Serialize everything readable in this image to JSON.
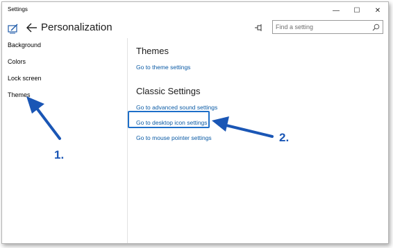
{
  "window": {
    "title": "Settings",
    "controls": {
      "minimize": "—",
      "maximize": "☐",
      "close": "✕"
    }
  },
  "header": {
    "page_title": "Personalization",
    "search_placeholder": "Find a setting"
  },
  "sidebar": {
    "items": [
      {
        "label": "Background"
      },
      {
        "label": "Colors"
      },
      {
        "label": "Lock screen"
      },
      {
        "label": "Themes"
      }
    ]
  },
  "main": {
    "themes_heading": "Themes",
    "theme_settings_link": "Go to theme settings",
    "classic_heading": "Classic Settings",
    "links": [
      {
        "label": "Go to advanced sound settings"
      },
      {
        "label": "Go to desktop icon settings"
      },
      {
        "label": "Go to mouse pointer settings"
      }
    ]
  },
  "annotations": {
    "step1": "1.",
    "step2": "2."
  },
  "colors": {
    "accent": "#1e6fc8",
    "link": "#0a5aa5",
    "annotation": "#1a56b5"
  }
}
